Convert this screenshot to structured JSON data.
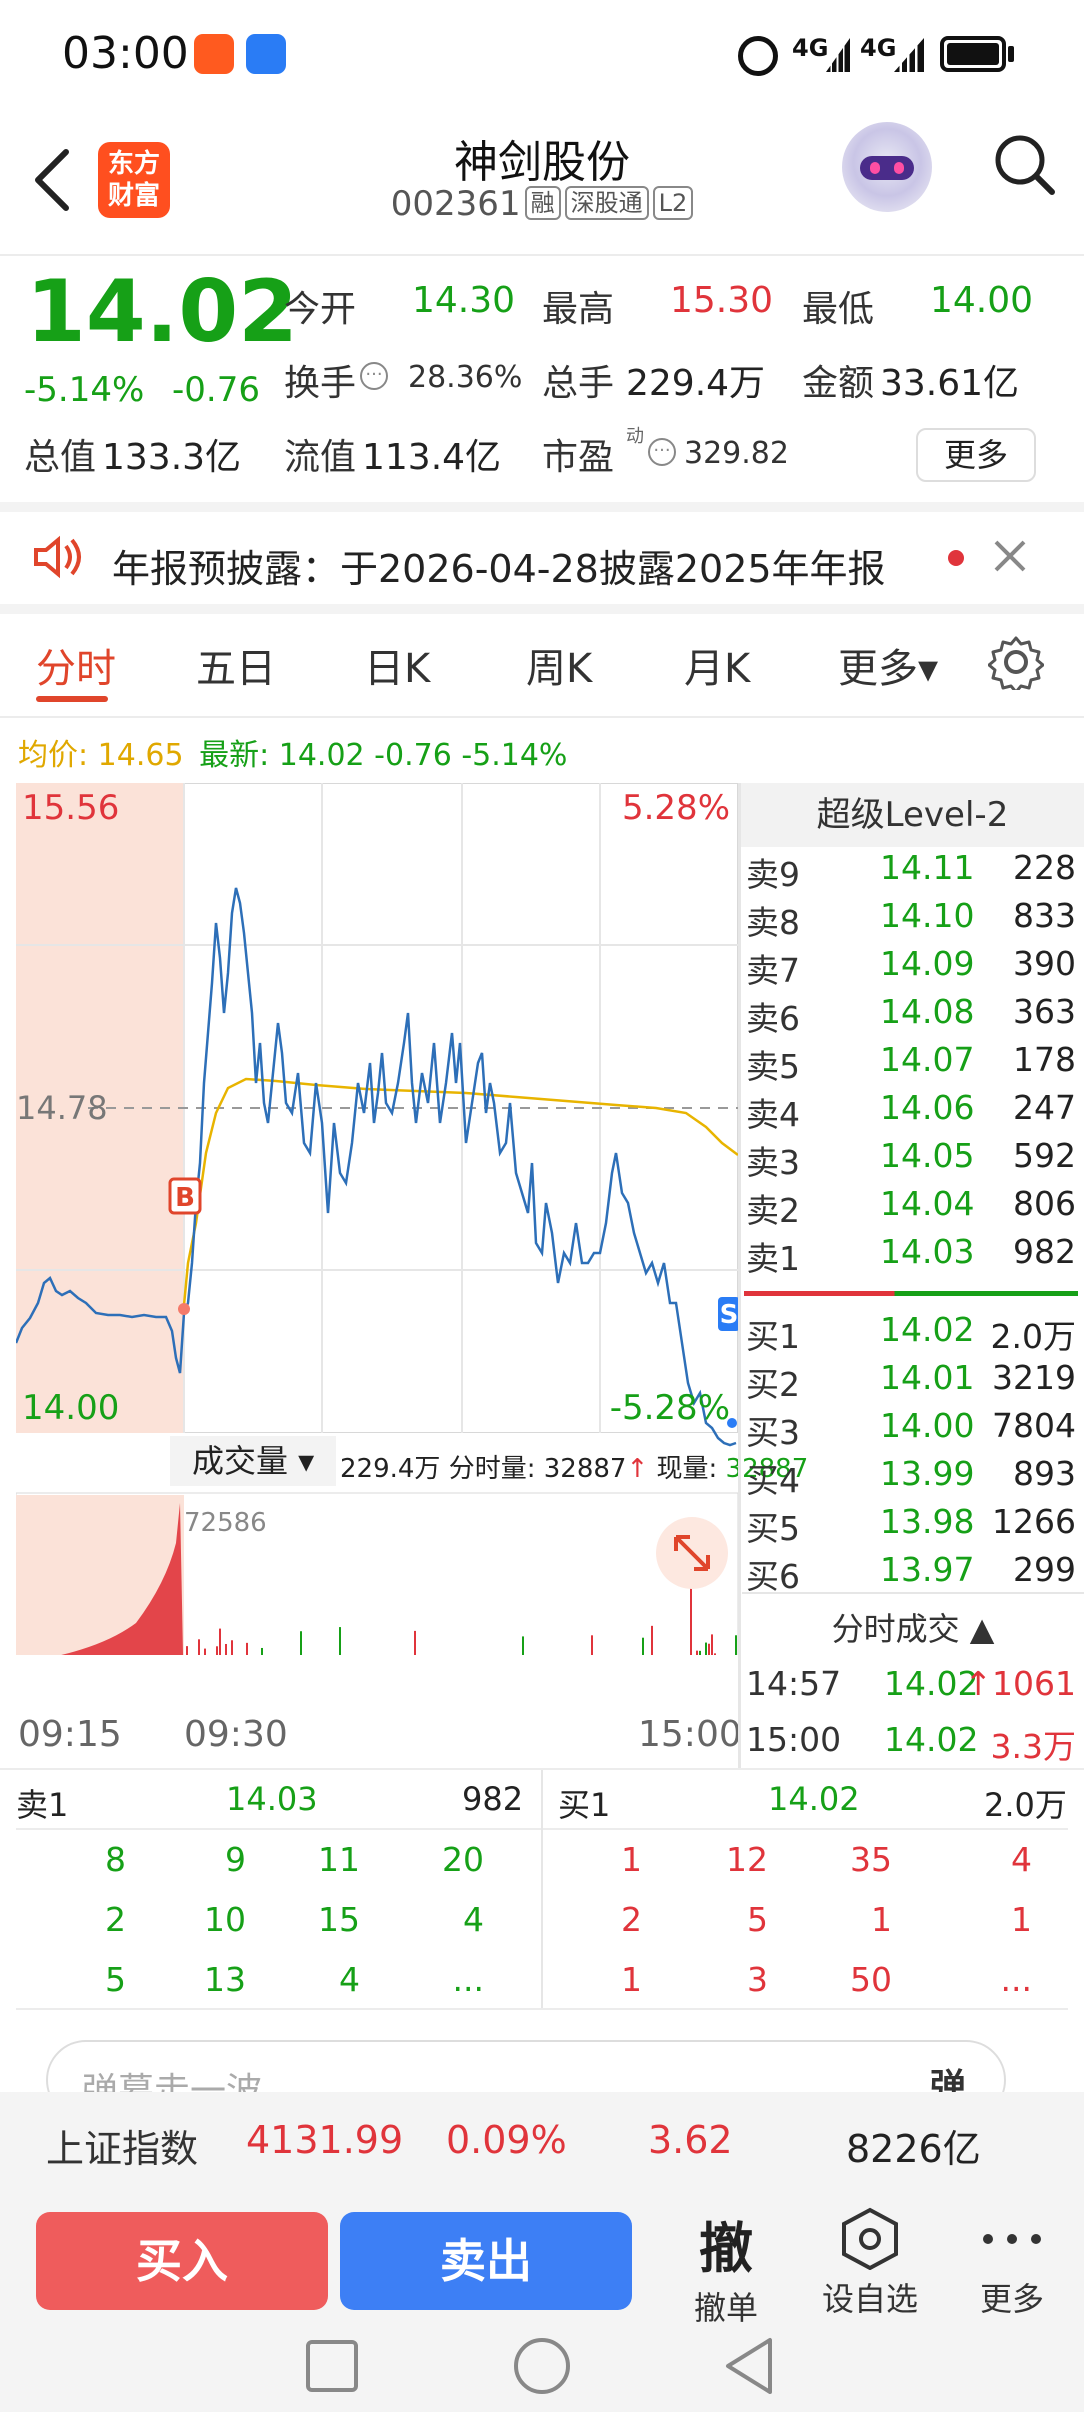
{
  "status_bar": {
    "time": "03:00",
    "network1": "4G",
    "network2": "4G"
  },
  "header": {
    "stock_name": "神剑股份",
    "stock_code": "002361",
    "tags": [
      "融",
      "深股通",
      "L2"
    ],
    "logo_line1": "东方",
    "logo_line2": "财富"
  },
  "quote": {
    "price": "14.02",
    "change_pct": "-5.14%",
    "change": "-0.76",
    "open_label": "今开",
    "open": "14.30",
    "high_label": "最高",
    "high": "15.30",
    "low_label": "最低",
    "low": "14.00",
    "turnover_label": "换手",
    "turnover": "28.36%",
    "volume_label": "总手",
    "volume": "229.4万",
    "amount_label": "金额",
    "amount": "33.61亿",
    "mktcap_label": "总值",
    "mktcap": "133.3亿",
    "float_label": "流值",
    "float_cap": "113.4亿",
    "pe_label": "市盈",
    "pe_sup": "动",
    "pe": "329.82",
    "more_label": "更多"
  },
  "notice": {
    "text": "年报预披露：于2026-04-28披露2025年年报"
  },
  "tabs": [
    {
      "label": "分时"
    },
    {
      "label": "五日"
    },
    {
      "label": "日K"
    },
    {
      "label": "周K"
    },
    {
      "label": "月K"
    },
    {
      "label": "更多▾"
    }
  ],
  "info_line": {
    "avg_label": "均价:",
    "avg": "14.65",
    "latest": "最新: 14.02 -0.76 -5.14%"
  },
  "chart": {
    "y_max": "15.56",
    "y_min": "14.00",
    "y_mid": "14.78",
    "pct_max": "5.28%",
    "pct_min": "-5.28%",
    "marker_b": "B",
    "marker_s": "S",
    "time_labels": [
      "09:15",
      "09:30",
      "15:00"
    ],
    "vol_selector": "成交量 ▾",
    "vol_info_total": "229.4万",
    "vol_info_label": "分时量:",
    "vol_info_value": "32887",
    "vol_info_now_label": "现量:",
    "vol_info_now": "32887",
    "vol_peak": "72586"
  },
  "chart_data": {
    "type": "line",
    "title": "",
    "ylim": [
      14.0,
      15.56
    ],
    "x": [
      "09:15",
      "09:30",
      "15:00"
    ],
    "series": []
  },
  "level2": {
    "title": "超级Level-2",
    "asks": [
      {
        "label": "卖9",
        "price": "14.11",
        "vol": "228"
      },
      {
        "label": "卖8",
        "price": "14.10",
        "vol": "833"
      },
      {
        "label": "卖7",
        "price": "14.09",
        "vol": "390"
      },
      {
        "label": "卖6",
        "price": "14.08",
        "vol": "363"
      },
      {
        "label": "卖5",
        "price": "14.07",
        "vol": "178"
      },
      {
        "label": "卖4",
        "price": "14.06",
        "vol": "247"
      },
      {
        "label": "卖3",
        "price": "14.05",
        "vol": "592"
      },
      {
        "label": "卖2",
        "price": "14.04",
        "vol": "806"
      },
      {
        "label": "卖1",
        "price": "14.03",
        "vol": "982"
      }
    ],
    "bids": [
      {
        "label": "买1",
        "price": "14.02",
        "vol": "2.0万"
      },
      {
        "label": "买2",
        "price": "14.01",
        "vol": "3219"
      },
      {
        "label": "买3",
        "price": "14.00",
        "vol": "7804"
      },
      {
        "label": "买4",
        "price": "13.99",
        "vol": "893"
      },
      {
        "label": "买5",
        "price": "13.98",
        "vol": "1266"
      },
      {
        "label": "买6",
        "price": "13.97",
        "vol": "299"
      }
    ],
    "ticks_title": "分时成交 ▲",
    "ticks": [
      {
        "time": "14:57",
        "price": "14.02",
        "vol": "1061",
        "arrow": "↑"
      },
      {
        "time": "15:00",
        "price": "14.02",
        "vol": "3.3万",
        "arrow": ""
      }
    ]
  },
  "queue": {
    "sell_label": "卖1",
    "sell_price": "14.03",
    "sell_vol": "982",
    "buy_label": "买1",
    "buy_price": "14.02",
    "buy_vol": "2.0万",
    "sell_rows": [
      [
        "8",
        "9",
        "11",
        "20"
      ],
      [
        "2",
        "10",
        "15",
        "4"
      ],
      [
        "5",
        "13",
        "4",
        "..."
      ]
    ],
    "buy_rows": [
      [
        "1",
        "12",
        "35",
        "4"
      ],
      [
        "2",
        "5",
        "1",
        "1"
      ],
      [
        "1",
        "3",
        "50",
        "..."
      ]
    ]
  },
  "danmu": {
    "placeholder": "弹幕走一波",
    "button": "弹"
  },
  "index_bar": {
    "name": "上证指数",
    "value": "4131.99",
    "pct": "0.09%",
    "change": "3.62",
    "amount": "8226亿"
  },
  "bottom_nav": {
    "buy": "买入",
    "sell": "卖出",
    "cancel_icon_text": "撤",
    "cancel": "撤单",
    "watchlist": "设自选",
    "more": "更多"
  },
  "colors": {
    "up": "#e0343b",
    "down": "#16a017",
    "accent": "#e0452b",
    "buy": "#ef5c5c",
    "sell": "#3d7ff5"
  }
}
